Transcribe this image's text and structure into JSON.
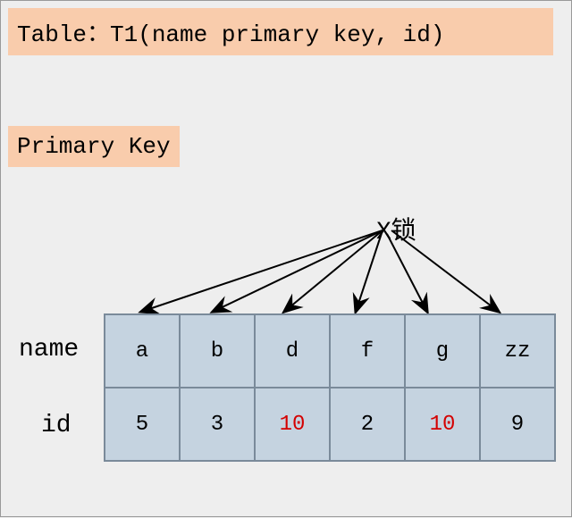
{
  "title": "Table：T1(name primary key, id)",
  "pk_label": "Primary Key",
  "xlock_label": "X锁",
  "row_labels": {
    "name": "name",
    "id": "id"
  },
  "columns": {
    "names": [
      "a",
      "b",
      "d",
      "f",
      "g",
      "zz"
    ],
    "ids": [
      "5",
      "3",
      "10",
      "2",
      "10",
      "9"
    ],
    "id_highlight": [
      false,
      false,
      true,
      false,
      true,
      false
    ]
  },
  "chart_data": {
    "type": "table",
    "title": "T1 primary key index, all entries X-locked",
    "columns": [
      "name",
      "id"
    ],
    "rows": [
      {
        "name": "a",
        "id": 5
      },
      {
        "name": "b",
        "id": 3
      },
      {
        "name": "d",
        "id": 10
      },
      {
        "name": "f",
        "id": 2
      },
      {
        "name": "g",
        "id": 10
      },
      {
        "name": "zz",
        "id": 9
      }
    ],
    "highlighted_id_value": 10,
    "lock_type": "X锁",
    "locked_names": [
      "a",
      "b",
      "d",
      "f",
      "g",
      "zz"
    ]
  }
}
